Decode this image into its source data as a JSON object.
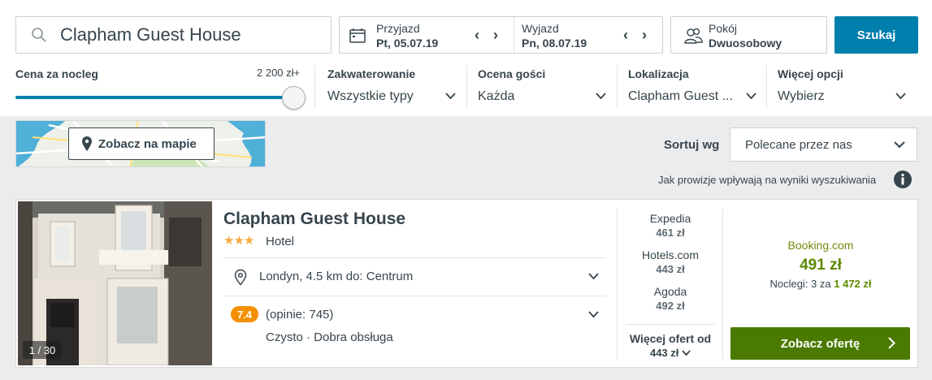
{
  "search": {
    "query": "Clapham Guest House",
    "checkin_label": "Przyjazd",
    "checkin_date": "Pt, 05.07.19",
    "checkout_label": "Wyjazd",
    "checkout_date": "Pn, 08.07.19",
    "date_arrows": "‹ ›",
    "room_label": "Pokój",
    "room_value": "Dwuosobowy",
    "search_button": "Szukaj"
  },
  "filters": {
    "price_label": "Cena za nocleg",
    "price_max": "2 200 zł+",
    "price_level_fraction": 1.0,
    "accommodation_label": "Zakwaterowanie",
    "accommodation_value": "Wszystkie typy",
    "rating_label": "Ocena gości",
    "rating_value": "Każda",
    "location_label": "Lokalizacja",
    "location_value": "Clapham Guest ...",
    "more_label": "Więcej opcji",
    "more_value": "Wybierz"
  },
  "map": {
    "button_label": "Zobacz na mapie"
  },
  "sort": {
    "label": "Sortuj wg",
    "value": "Polecane przez nas"
  },
  "commission_note": "Jak prowizje wpływają na wyniki wyszukiwania",
  "hotel": {
    "name": "Clapham Guest House",
    "stars": 3,
    "stars_text": "★★★",
    "type": "Hotel",
    "photo_counter": "1 / 30",
    "location": "Londyn, 4.5 km do: Centrum",
    "rating": "7.4",
    "reviews": "(opinie: 745)",
    "tags": "Czysto · Dobra obsługa",
    "offers": [
      {
        "provider": "Expedia",
        "price": "461 zł"
      },
      {
        "provider": "Hotels.com",
        "price": "443 zł"
      },
      {
        "provider": "Agoda",
        "price": "492 zł"
      }
    ],
    "more_offers_label": "Więcej ofert od",
    "more_offers_price": "443 zł",
    "best_provider": "Booking.com",
    "best_price": "491 zł",
    "nights_text": "Noclegi: 3 za",
    "nights_total": "1 472 zł",
    "cta_label": "Zobacz ofertę"
  },
  "colors": {
    "accent_blue": "#007fad",
    "cta_green": "#4a7a00",
    "rating_orange": "#f48f00",
    "star_yellow": "#f6ab3f"
  }
}
